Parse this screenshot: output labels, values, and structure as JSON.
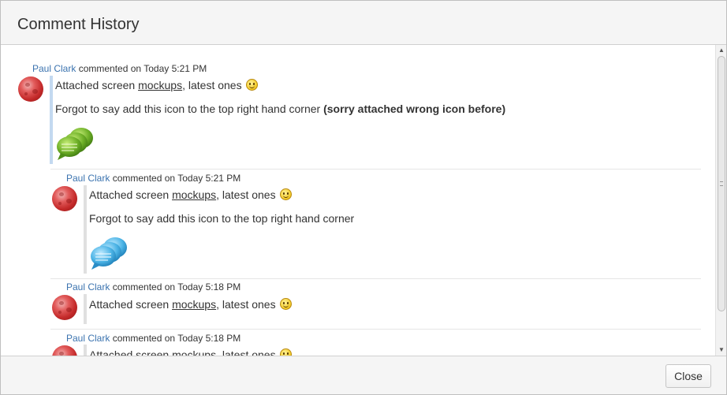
{
  "dialog": {
    "title": "Comment History",
    "close_label": "Close"
  },
  "colors": {
    "author_link": "#3b73af",
    "first_comment_bar": "#c3d9f0",
    "reply_bar": "#e0e0e0"
  },
  "comments": [
    {
      "author": "Paul Clark",
      "action": "commented on",
      "time": "Today 5:21 PM",
      "line1_prefix": "Attached screen ",
      "line1_link": "mockups",
      "line1_suffix": ", latest ones",
      "line2": "Forgot to say add this icon to the top right hand corner ",
      "line2_bold": "(sorry attached wrong icon before)",
      "attachment_icon": "green-chat-bubbles-icon"
    },
    {
      "author": "Paul Clark",
      "action": "commented on",
      "time": "Today 5:21 PM",
      "line1_prefix": "Attached screen ",
      "line1_link": "mockups",
      "line1_suffix": ", latest ones",
      "line2": "Forgot to say add this icon to the top right hand corner",
      "attachment_icon": "blue-chat-bubbles-icon"
    },
    {
      "author": "Paul Clark",
      "action": "commented on",
      "time": "Today 5:18 PM",
      "line1_prefix": "Attached screen ",
      "line1_link": "mockups",
      "line1_suffix": ", latest ones"
    },
    {
      "author": "Paul Clark",
      "action": "commented on",
      "time": "Today 5:18 PM",
      "line1_prefix": "Attached screen ",
      "line1_link": "mockups",
      "line1_suffix": ", latest ones"
    }
  ]
}
